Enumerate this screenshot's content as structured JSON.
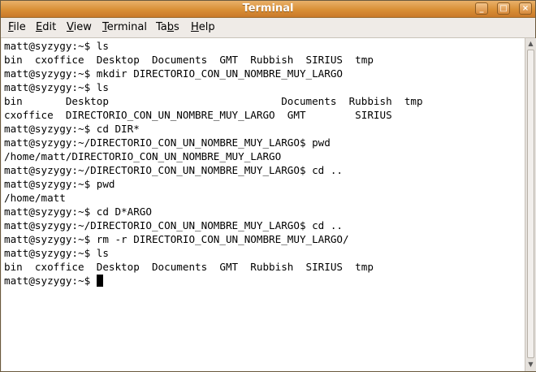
{
  "window": {
    "title": "Terminal",
    "buttons": {
      "minimize": "_",
      "maximize": "□",
      "close": "×"
    }
  },
  "menubar": [
    {
      "mnemonic": "F",
      "rest": "ile"
    },
    {
      "mnemonic": "E",
      "rest": "dit"
    },
    {
      "mnemonic": "V",
      "rest": "iew"
    },
    {
      "mnemonic": "T",
      "rest": "erminal"
    },
    {
      "prefix": "Ta",
      "mnemonic": "b",
      "rest": "s"
    },
    {
      "mnemonic": "H",
      "rest": "elp"
    }
  ],
  "terminal": {
    "lines": [
      "matt@syzygy:~$ ls",
      "bin  cxoffice  Desktop  Documents  GMT  Rubbish  SIRIUS  tmp",
      "matt@syzygy:~$ mkdir DIRECTORIO_CON_UN_NOMBRE_MUY_LARGO",
      "matt@syzygy:~$ ls",
      "bin       Desktop                            Documents  Rubbish  tmp",
      "cxoffice  DIRECTORIO_CON_UN_NOMBRE_MUY_LARGO  GMT        SIRIUS",
      "matt@syzygy:~$ cd DIR*",
      "matt@syzygy:~/DIRECTORIO_CON_UN_NOMBRE_MUY_LARGO$ pwd",
      "/home/matt/DIRECTORIO_CON_UN_NOMBRE_MUY_LARGO",
      "matt@syzygy:~/DIRECTORIO_CON_UN_NOMBRE_MUY_LARGO$ cd ..",
      "matt@syzygy:~$ pwd",
      "/home/matt",
      "matt@syzygy:~$ cd D*ARGO",
      "matt@syzygy:~/DIRECTORIO_CON_UN_NOMBRE_MUY_LARGO$ cd ..",
      "matt@syzygy:~$ rm -r DIRECTORIO_CON_UN_NOMBRE_MUY_LARGO/",
      "matt@syzygy:~$ ls",
      "bin  cxoffice  Desktop  Documents  GMT  Rubbish  SIRIUS  tmp"
    ],
    "prompt": "matt@syzygy:~$ "
  },
  "icons": {
    "scroll_up": "scroll-up-arrow-icon",
    "scroll_down": "scroll-down-arrow-icon"
  }
}
